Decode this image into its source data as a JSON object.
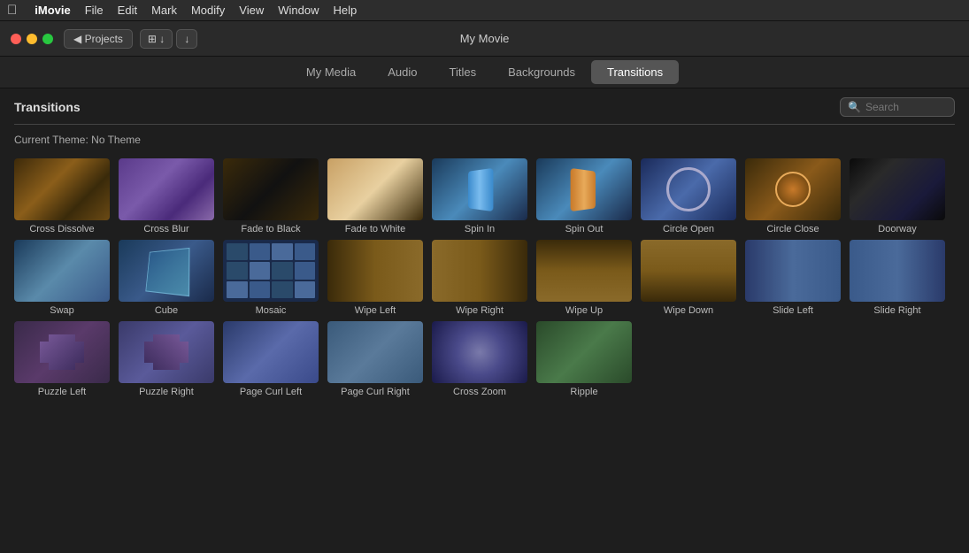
{
  "menubar": {
    "apple": "⌘",
    "app": "iMovie",
    "items": [
      "File",
      "Edit",
      "Mark",
      "Modify",
      "View",
      "Window",
      "Help"
    ]
  },
  "titlebar": {
    "projects_label": "◀ Projects",
    "movie_title": "My Movie"
  },
  "navtabs": {
    "tabs": [
      {
        "id": "my-media",
        "label": "My Media",
        "active": false
      },
      {
        "id": "audio",
        "label": "Audio",
        "active": false
      },
      {
        "id": "titles",
        "label": "Titles",
        "active": false
      },
      {
        "id": "backgrounds",
        "label": "Backgrounds",
        "active": false
      },
      {
        "id": "transitions",
        "label": "Transitions",
        "active": true
      }
    ]
  },
  "toolbar": {
    "section_title": "Transitions",
    "search_placeholder": "Search"
  },
  "content": {
    "current_theme_label": "Current Theme: No Theme"
  },
  "transitions": [
    {
      "id": "cross-dissolve",
      "label": "Cross Dissolve"
    },
    {
      "id": "cross-blur",
      "label": "Cross Blur"
    },
    {
      "id": "fade-to-black",
      "label": "Fade to Black"
    },
    {
      "id": "fade-to-white",
      "label": "Fade to White"
    },
    {
      "id": "spin-in",
      "label": "Spin In"
    },
    {
      "id": "spin-out",
      "label": "Spin Out"
    },
    {
      "id": "circle-open",
      "label": "Circle Open"
    },
    {
      "id": "circle-close",
      "label": "Circle Close"
    },
    {
      "id": "doorway",
      "label": "Doorway"
    },
    {
      "id": "swap",
      "label": "Swap"
    },
    {
      "id": "cube",
      "label": "Cube"
    },
    {
      "id": "mosaic",
      "label": "Mosaic"
    },
    {
      "id": "wipe-left",
      "label": "Wipe Left"
    },
    {
      "id": "wipe-right",
      "label": "Wipe Right"
    },
    {
      "id": "wipe-up",
      "label": "Wipe Up"
    },
    {
      "id": "wipe-down",
      "label": "Wipe Down"
    },
    {
      "id": "slide-left",
      "label": "Slide Left"
    },
    {
      "id": "slide-right",
      "label": "Slide Right"
    },
    {
      "id": "puzzle-left",
      "label": "Puzzle Left"
    },
    {
      "id": "puzzle-right",
      "label": "Puzzle Right"
    },
    {
      "id": "page-curl-left",
      "label": "Page Curl Left"
    },
    {
      "id": "page-curl-right",
      "label": "Page Curl Right"
    },
    {
      "id": "cross-zoom",
      "label": "Cross Zoom"
    },
    {
      "id": "ripple",
      "label": "Ripple"
    }
  ]
}
